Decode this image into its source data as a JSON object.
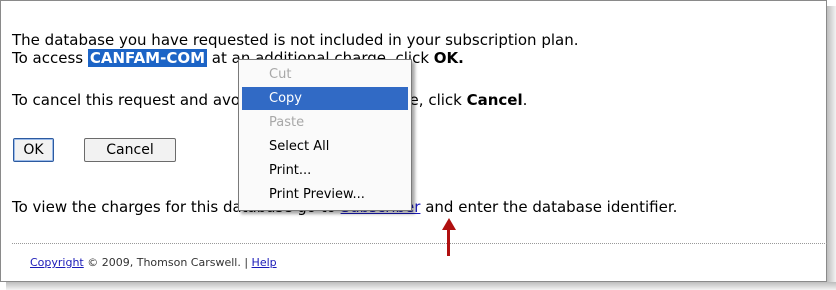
{
  "message": {
    "line1": "The database you have requested is not included in your subscription plan.",
    "line2_prefix": "To access ",
    "database_id": "CANFAM-COM",
    "line2_mid": " at an additional charge, click ",
    "ok_word": "OK.",
    "line3_prefix": "To cancel this request and avoid the additional charge, click ",
    "cancel_word": "Cancel",
    "line3_suffix": ".",
    "line4_prefix": "To view the charges for this database go to ",
    "subscriber_link": "Subscriber",
    "line4_suffix": " and enter the database identifier."
  },
  "buttons": {
    "ok": "OK",
    "cancel": "Cancel"
  },
  "footer": {
    "copyright_link": "Copyright",
    "copyright_text": " © 2009, Thomson Carswell. | ",
    "help_link": "Help"
  },
  "context_menu": {
    "items": [
      {
        "label": "Cut",
        "state": "disabled"
      },
      {
        "label": "Copy",
        "state": "highlighted"
      },
      {
        "label": "Paste",
        "state": "disabled"
      },
      {
        "label": "Select All",
        "state": "enabled"
      },
      {
        "label": "Print...",
        "state": "enabled"
      },
      {
        "label": "Print Preview...",
        "state": "enabled"
      }
    ]
  },
  "colors": {
    "selection": "#1c64c6",
    "menu_highlight": "#316ac5",
    "link": "#1a1ab8",
    "annotation_arrow": "#b01010"
  }
}
